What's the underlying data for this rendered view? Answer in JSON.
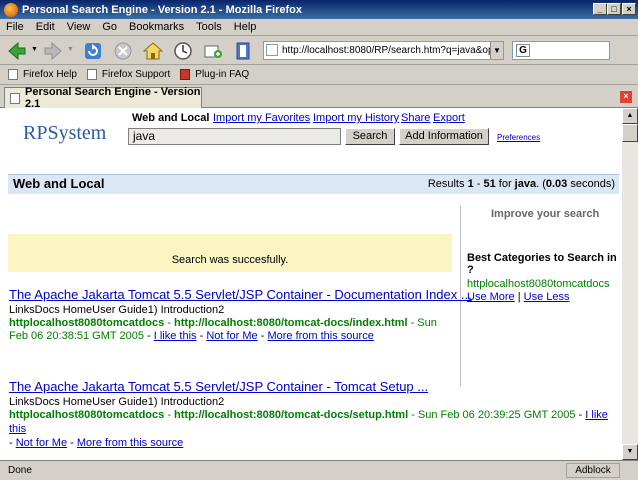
{
  "window": {
    "title": "Personal Search Engine - Version 2.1 - Mozilla Firefox"
  },
  "menu": [
    "File",
    "Edit",
    "View",
    "Go",
    "Bookmarks",
    "Tools",
    "Help"
  ],
  "nav": {
    "url": "http://localhost:8080/RP/search.htm?q=java&operatio"
  },
  "bookmarks": [
    "Firefox Help",
    "Firefox Support",
    "Plug-in FAQ"
  ],
  "tab": {
    "title": "Personal Search Engine - Version 2.1"
  },
  "page": {
    "logo": "RPSystem",
    "scope_label": "Web and Local",
    "nav_links": [
      "Import my Favorites",
      "Import my History",
      "Share",
      "Export"
    ],
    "search_value": "java",
    "search_button": "Search",
    "add_button": "Add Information",
    "preferences": "Preferences",
    "results_header": {
      "title": "Web and Local",
      "prefix": "Results ",
      "from": "1",
      "dash": " - ",
      "to": "51",
      "for": " for ",
      "query": "java",
      "dot": ". (",
      "time": "0.03",
      "suffix": " seconds)"
    },
    "success_message": "Search was succesfully.",
    "results": [
      {
        "title": "The Apache Jakarta Tomcat 5.5 Servlet/JSP Container - Documentation Index ...",
        "snippet": "LinksDocs HomeUser Guide1) Introduction2",
        "source": "httplocalhost8080tomcatdocs",
        "sep1": " - ",
        "url": "http://localhost:8080/tomcat-docs/index.html",
        "date": " - Sun Feb 06 20:38:51 GMT 2005",
        "sep2": " - ",
        "like": "I like this",
        "notfor": "Not for Me",
        "more": "More from this source"
      },
      {
        "title": "The Apache Jakarta Tomcat 5.5 Servlet/JSP Container - Tomcat Setup ...",
        "snippet": "LinksDocs HomeUser Guide1) Introduction2",
        "source": "httplocalhost8080tomcatdocs",
        "sep1": " - ",
        "url": "http://localhost:8080/tomcat-docs/setup.html",
        "date": " - Sun Feb 06 20:39:25 GMT 2005",
        "sep2": " - ",
        "like": "I like this",
        "notfor": "Not for Me",
        "more": "More from this source"
      }
    ],
    "sidebar": {
      "improve": "Improve your search",
      "categories_title": "Best Categories to Search in ?",
      "category": "httplocalhost8080tomcatdocs",
      "use_more": "Use More",
      "use_less": "Use Less",
      "sep": " | "
    }
  },
  "status": {
    "text": "Done",
    "adblock": "Adblock"
  },
  "colors": {
    "titlebar": "#0a246a",
    "header_bg": "#dbe7f4",
    "success_bg": "#fbf5c4",
    "link": "#0000cc",
    "green": "#008000",
    "logo": "#2a5aa0"
  }
}
